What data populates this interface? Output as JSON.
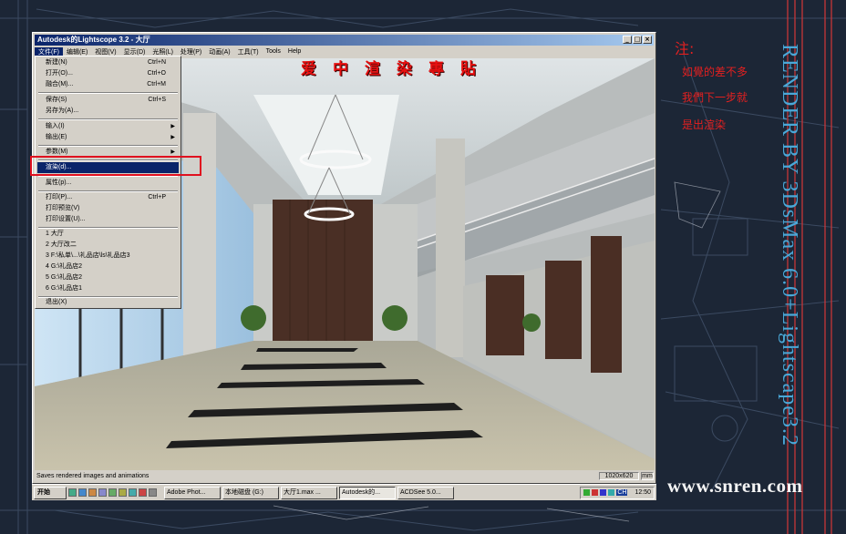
{
  "window": {
    "title": "Autodesk的Lightscope 3.2 - 大厅",
    "controls": [
      "_",
      "□",
      "×"
    ]
  },
  "menubar": [
    "文件(F)",
    "编辑(E)",
    "视图(V)",
    "显示(D)",
    "光照(L)",
    "处理(P)",
    "动画(A)",
    "工具(T)",
    "Tools",
    "Help"
  ],
  "file_menu": [
    {
      "label": "新建(N)",
      "shortcut": "Ctrl+N"
    },
    {
      "label": "打开(O)...",
      "shortcut": "Ctrl+O"
    },
    {
      "label": "融合(M)...",
      "shortcut": "Ctrl+M"
    },
    {
      "label": "保存(S)",
      "shortcut": "Ctrl+S"
    },
    {
      "label": "另存为(A)...",
      "shortcut": ""
    },
    {
      "label": "输入(I)",
      "shortcut": "",
      "arrow": "▶"
    },
    {
      "label": "输出(E)",
      "shortcut": "",
      "arrow": "▶"
    },
    {
      "label": "参数(M)",
      "shortcut": "",
      "arrow": "▶"
    },
    {
      "label": "渲染(d)...",
      "shortcut": ""
    },
    {
      "label": "属性(p)...",
      "shortcut": ""
    },
    {
      "label": "打印(P)...",
      "shortcut": "Ctrl+P"
    },
    {
      "label": "打印预览(V)",
      "shortcut": ""
    },
    {
      "label": "打印设置(U)...",
      "shortcut": ""
    },
    {
      "label": "1 大厅",
      "shortcut": ""
    },
    {
      "label": "2 大厅改二",
      "shortcut": ""
    },
    {
      "label": "3 F:\\私单\\...\\礼品店\\ls\\礼品店3",
      "shortcut": ""
    },
    {
      "label": "4 G:\\礼品店2",
      "shortcut": ""
    },
    {
      "label": "5 G:\\礼品店2",
      "shortcut": ""
    },
    {
      "label": "6 G:\\礼品店1",
      "shortcut": ""
    },
    {
      "label": "退出(X)",
      "shortcut": ""
    }
  ],
  "toolbar2_letters": [
    "X",
    "Y",
    "Z",
    "XY",
    "YZ",
    "XZ"
  ],
  "overlay_title": [
    "爱",
    "中",
    "渲",
    "染",
    "專",
    "貼"
  ],
  "status": {
    "message": "Saves rendered images and animations",
    "resolution": "1020x620",
    "unit": "mm"
  },
  "taskbar": {
    "start": "开始",
    "tasks": [
      "Adobe Phot...",
      "本地磁盘 (G:)",
      "大厅1.max ...",
      "Autodesk的...",
      "ACDSee 5.0..."
    ],
    "active_task": 3,
    "clock": "12:50",
    "lang": "CH"
  },
  "notes": {
    "heading": "注:",
    "lines": [
      "如覺的差不多",
      "我們下一步就",
      "是出渲染"
    ]
  },
  "vertical_text": "RENDER BY 3DsMax 6.0+Lightscape3.2",
  "website": "www.snren.com",
  "colors": {
    "titlebar": "#0a246a",
    "accent_red": "#e22020",
    "vertical_text": "#4aa8d8"
  }
}
